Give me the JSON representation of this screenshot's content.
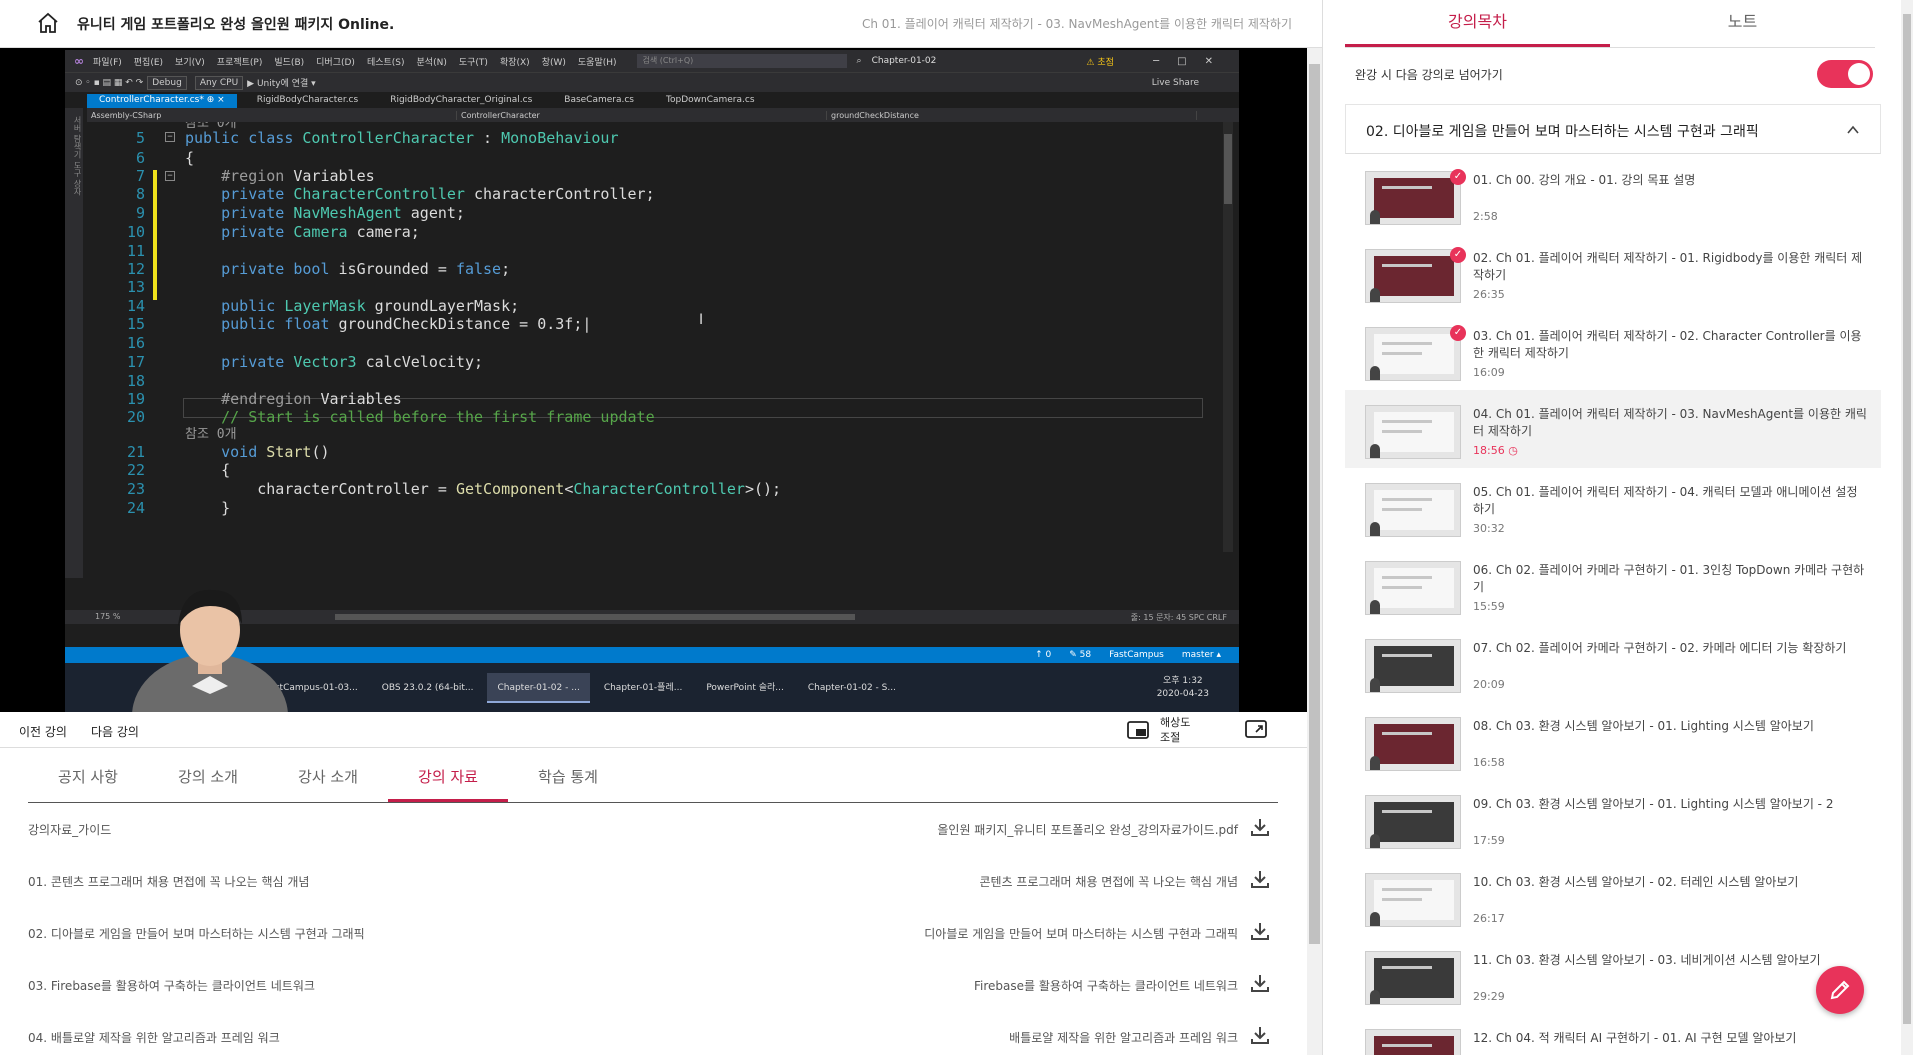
{
  "header": {
    "course_title": "유니티 게임 포트폴리오 완성 올인원 패키지 Online.",
    "lecture_title": "Ch 01. 플레이어 캐릭터 제작하기 - 03. NavMeshAgent를 이용한 캐릭터 제작하기"
  },
  "video": {
    "menu": [
      "파일(F)",
      "편집(E)",
      "보기(V)",
      "프로젝트(P)",
      "빌드(B)",
      "디버그(D)",
      "테스트(S)",
      "분석(N)",
      "도구(T)",
      "확장(X)",
      "창(W)",
      "도움말(H)"
    ],
    "search_placeholder": "검색 (Ctrl+Q)",
    "solution": "Chapter-01-02",
    "warning": "⚠ 초점",
    "toolbar_config": "Debug",
    "toolbar_platform": "Any CPU",
    "toolbar_run": "▶ Unity에 연결 ▾",
    "live_share": "Live Share",
    "tabs": [
      "ControllerCharacter.cs* ⊕ ×",
      "RigidBodyCharacter.cs",
      "RigidBodyCharacter_Original.cs",
      "BaseCamera.cs",
      "TopDownCamera.cs"
    ],
    "nav": [
      "Assembly-CSharp",
      "ControllerCharacter",
      "groundCheckDistance"
    ],
    "side_strip": "서버 탐색기 도구 상자",
    "ref_hint": "참조 0개",
    "zoom": "175 %",
    "cursor_info": "줄: 15   문자: 45   SPC   CRLF",
    "status_items": [
      "↑ 0",
      "✎ 58",
      "FastCampus",
      "master ▴"
    ],
    "taskbar": [
      "FastCampus-01-03...",
      "OBS 23.0.2 (64-bit...",
      "Chapter-01-02 - ...",
      "Chapter-01-플레...",
      "PowerPoint 슬라...",
      "Chapter-01-02 - S..."
    ],
    "clock_time": "오후 1:32",
    "clock_date": "2020-04-23"
  },
  "controls": {
    "prev": "이전 강의",
    "next": "다음 강의",
    "resolution": "해상도 조절"
  },
  "content_tabs": [
    {
      "label": "공지 사항"
    },
    {
      "label": "강의 소개"
    },
    {
      "label": "강사 소개"
    },
    {
      "label": "강의 자료",
      "active": true
    },
    {
      "label": "학습 통계"
    }
  ],
  "materials": [
    {
      "name": "강의자료_가이드",
      "file": "올인원 패키지_유니티 포트폴리오 완성_강의자료가이드.pdf"
    },
    {
      "name": "01. 콘텐츠 프로그래머 채용 면접에 꼭 나오는 핵심 개념",
      "file": "콘텐츠 프로그래머 채용 면접에 꼭 나오는 핵심 개념"
    },
    {
      "name": "02. 디아블로 게임을 만들어 보며 마스터하는 시스템 구현과 그래픽",
      "file": "디아블로 게임을 만들어 보며 마스터하는 시스템 구현과 그래픽"
    },
    {
      "name": "03. Firebase를 활용하여 구축하는 클라이언트 네트워크",
      "file": "Firebase를 활용하여 구축하는 클라이언트 네트워크"
    },
    {
      "name": "04. 배틀로얄 제작을 위한 알고리즘과 프레임 워크",
      "file": "배틀로얄 제작을 위한 알고리즘과 프레임 워크"
    }
  ],
  "sidebar": {
    "tabs": [
      {
        "label": "강의목차",
        "active": true
      },
      {
        "label": "노트"
      }
    ],
    "autoplay_label": "완강 시 다음 강의로 넘어가기",
    "section_title": "02. 디아블로 게임을 만들어 보며 마스터하는 시스템 구현과 그래픽",
    "lessons": [
      {
        "title": "01. Ch 00. 강의 개요 - 01. 강의 목표 설명",
        "duration": "2:58",
        "done": true
      },
      {
        "title": "02. Ch 01. 플레이어 캐릭터 제작하기 - 01. Rigidbody를 이용한 캐릭터 제작하기",
        "duration": "26:35",
        "done": true
      },
      {
        "title": "03. Ch 01. 플레이어 캐릭터 제작하기 - 02. Character Controller를 이용한 캐릭터 제작하기",
        "duration": "16:09",
        "done": true
      },
      {
        "title": "04. Ch 01. 플레이어 캐릭터 제작하기 - 03. NavMeshAgent를 이용한 캐릭터 제작하기",
        "duration": "18:56",
        "current": true
      },
      {
        "title": "05. Ch 01. 플레이어 캐릭터 제작하기 - 04. 캐릭터 모델과 애니메이션 설정하기",
        "duration": "30:32"
      },
      {
        "title": "06. Ch 02. 플레이어 카메라 구현하기 - 01. 3인칭 TopDown 카메라 구현하기",
        "duration": "15:59"
      },
      {
        "title": "07. Ch 02. 플레이어 카메라 구현하기 - 02. 카메라 에디터 기능 확장하기",
        "duration": "20:09"
      },
      {
        "title": "08. Ch 03. 환경 시스템 알아보기 - 01. Lighting 시스템 알아보기",
        "duration": "16:58"
      },
      {
        "title": "09. Ch 03. 환경 시스템 알아보기 - 01. Lighting 시스템 알아보기 - 2",
        "duration": "17:59"
      },
      {
        "title": "10. Ch 03. 환경 시스템 알아보기 - 02. 터레인 시스템 알아보기",
        "duration": "26:17"
      },
      {
        "title": "11. Ch 03. 환경 시스템 알아보기 - 03. 네비게이션 시스템 알아보기",
        "duration": "29:29"
      },
      {
        "title": "12. Ch 04. 적 캐릭터 AI 구현하기 - 01. AI 구현 모델 알아보기",
        "duration": ""
      }
    ]
  },
  "colors": {
    "accent": "#e8335a",
    "tab_active": "#c41e4a"
  }
}
